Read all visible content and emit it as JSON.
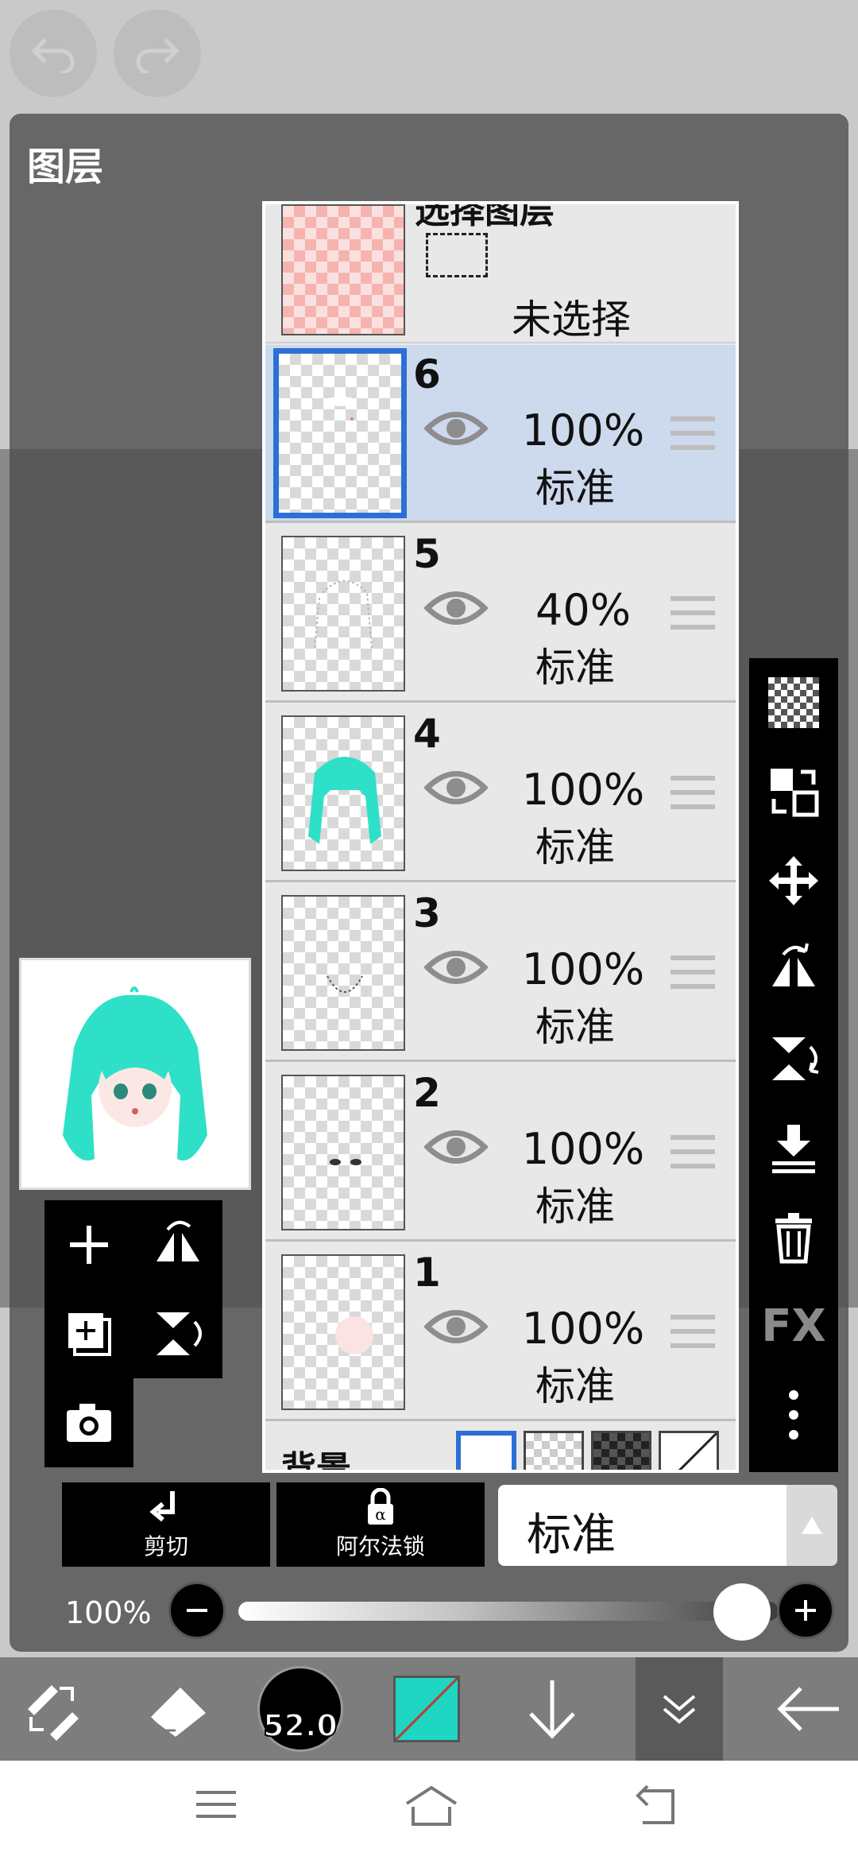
{
  "panel": {
    "title": "图层"
  },
  "selection": {
    "title": "选择图层",
    "status": "未选择"
  },
  "layers": [
    {
      "number": "6",
      "opacity": "100%",
      "blend": "标准",
      "active": true
    },
    {
      "number": "5",
      "opacity": "40%",
      "blend": "标准",
      "active": false
    },
    {
      "number": "4",
      "opacity": "100%",
      "blend": "标准",
      "active": false
    },
    {
      "number": "3",
      "opacity": "100%",
      "blend": "标准",
      "active": false
    },
    {
      "number": "2",
      "opacity": "100%",
      "blend": "标准",
      "active": false
    },
    {
      "number": "1",
      "opacity": "100%",
      "blend": "标准",
      "active": false
    }
  ],
  "background": {
    "label": "背景"
  },
  "actions": {
    "clip_label": "剪切",
    "alpha_lock_label": "阿尔法锁"
  },
  "blend_mode": {
    "value": "标准"
  },
  "opacity_control": {
    "label": "100%",
    "value": 1.0
  },
  "toolbar": {
    "brush_size": "52.0",
    "color": "#1ed6c3"
  },
  "right_tools": {
    "fx_label": "FX"
  },
  "colors": {
    "accent": "#2d6fd6",
    "hair": "#2fe0c9"
  }
}
